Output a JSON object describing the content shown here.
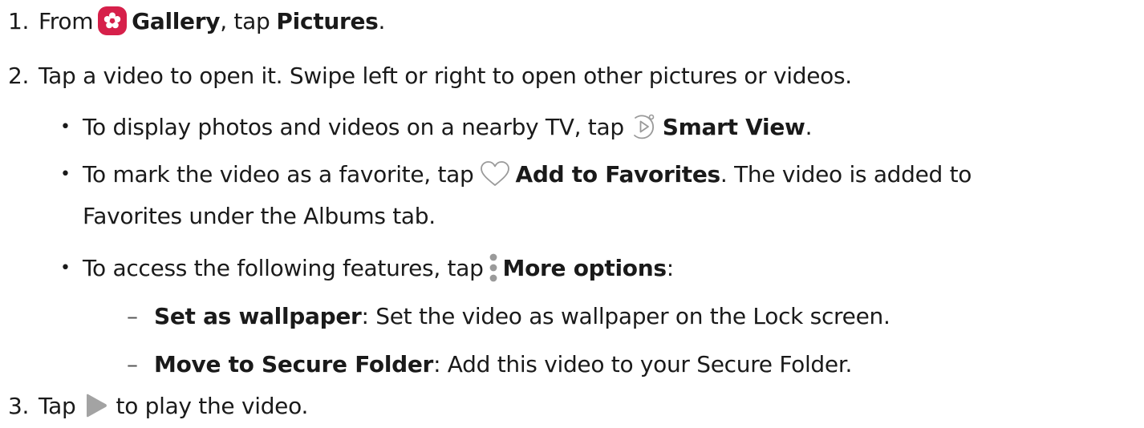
{
  "steps": [
    {
      "number": "1.",
      "t1": "From",
      "t2": "Gallery",
      "t3": ", tap",
      "t4": "Pictures",
      "t5": "."
    },
    {
      "number": "2.",
      "text": "Tap a video to open it. Swipe left or right to open other pictures or videos."
    },
    {
      "number": "3.",
      "t1": "Tap",
      "t2": "to play the video."
    }
  ],
  "bullets": [
    {
      "t1": "To display photos and videos on a nearby TV, tap",
      "t2": "Smart View",
      "t3": "."
    },
    {
      "t1": "To mark the video as a favorite, tap",
      "t2": "Add to Favorites",
      "t3": ". The video is added to",
      "cont": "Favorites under the Albums tab."
    },
    {
      "t1": "To access the following features, tap",
      "t2": "More options",
      "t3": ":"
    }
  ],
  "subitems": [
    {
      "t1": "Set as wallpaper",
      "t2": ": Set the video as wallpaper on the Lock screen."
    },
    {
      "t1": "Move to Secure Folder",
      "t2": ": Add this video to your Secure Folder."
    }
  ],
  "symbols": {
    "bullet": "•",
    "dash": "–"
  },
  "icons": {
    "gallery": "gallery-app-icon",
    "smart_view": "smart-view-icon",
    "favorite": "heart-icon",
    "more": "more-options-icon",
    "play": "play-icon"
  },
  "colors": {
    "gallery_icon_bg": "#d6204a",
    "icon_gray": "#9a9a9a",
    "text": "#1a1a1a"
  }
}
